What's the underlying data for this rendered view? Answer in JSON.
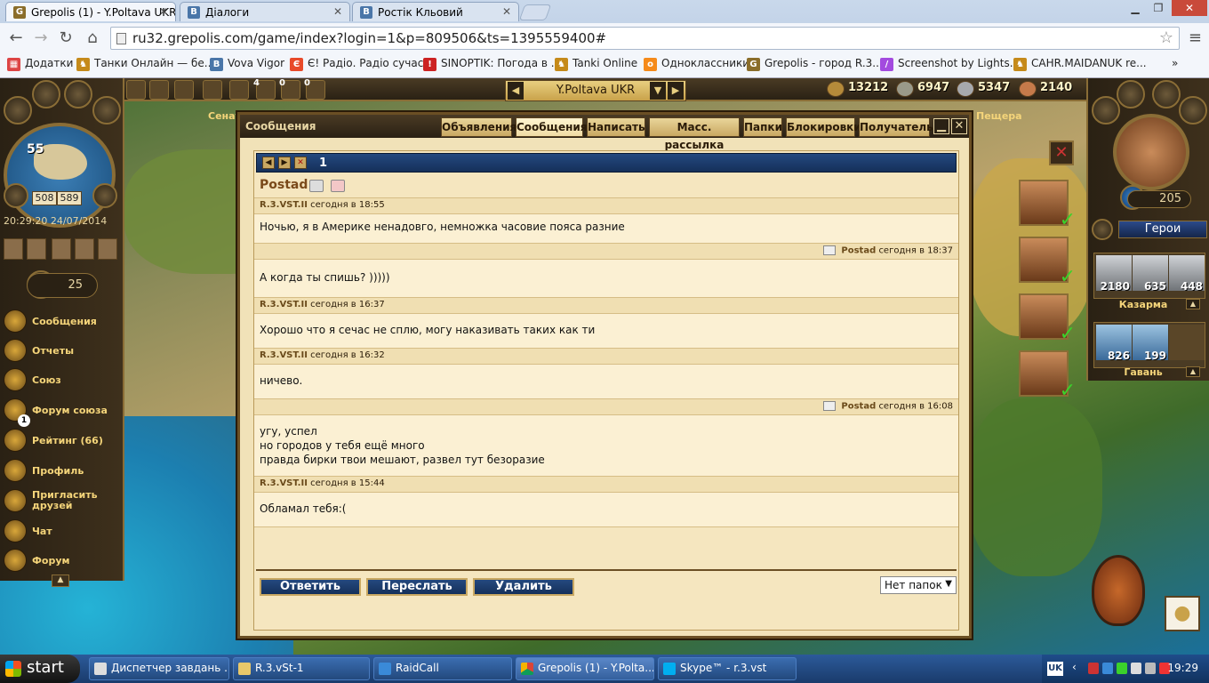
{
  "browser": {
    "tabs": [
      {
        "label": "Grepolis (1) - Y.Poltava UKR",
        "favicon": "G",
        "color": "#8a6d2a"
      },
      {
        "label": "Діалоги",
        "favicon": "В",
        "color": "#4a76a8"
      },
      {
        "label": "Ростік Кльовий",
        "favicon": "В",
        "color": "#4a76a8"
      }
    ],
    "url": "ru32.grepolis.com/game/index?login=1&p=809506&ts=1395559400#",
    "bookmarks": [
      {
        "label": "Додатки",
        "color": "#d44"
      },
      {
        "label": "Танки Онлайн — бе...",
        "color": "#c58a1a"
      },
      {
        "label": "Vova Vigor",
        "color": "#4a76a8"
      },
      {
        "label": "Є! Радіо. Радіо сучас...",
        "color": "#e84a2a"
      },
      {
        "label": "SINOPTIK: Погода в ...",
        "color": "#c22"
      },
      {
        "label": "Tanki Online",
        "color": "#c58a1a"
      },
      {
        "label": "Одноклассники",
        "color": "#f58a1a"
      },
      {
        "label": "Grepolis - город R.3....",
        "color": "#8a6d2a"
      },
      {
        "label": "Screenshot by Lights...",
        "color": "#a34adf"
      },
      {
        "label": "CAHR.MAIDANUK re...",
        "color": "#c58a1a"
      }
    ],
    "more": "»"
  },
  "game": {
    "town_name": "Y.Poltava UKR",
    "resources": {
      "wood": "13212",
      "stone": "6947",
      "silver": "5347",
      "population": "2140"
    },
    "tools": {
      "count_a": "4",
      "count_b": "0",
      "count_c": "0"
    },
    "map_labels": {
      "senate": "Сенат",
      "cave": "Пещера"
    },
    "level": "55",
    "coords": {
      "x": "508",
      "y": "589"
    },
    "clock": "20:29:20 24/07/2014",
    "favor": "25",
    "menu": [
      {
        "label": "Сообщения",
        "name": "menu-messages"
      },
      {
        "label": "Отчеты",
        "name": "menu-reports"
      },
      {
        "label": "Союз",
        "name": "menu-alliance"
      },
      {
        "label": "Форум союза",
        "name": "menu-alliance-forum",
        "badge": "1"
      },
      {
        "label": "Рейтинг (66)",
        "name": "menu-ranking"
      },
      {
        "label": "Профиль",
        "name": "menu-profile"
      },
      {
        "label": "Пригласить друзей",
        "name": "menu-invite"
      },
      {
        "label": "Чат",
        "name": "menu-chat"
      },
      {
        "label": "Форум",
        "name": "menu-forum"
      }
    ],
    "hero_count": "205",
    "heroes_label": "Герои",
    "barracks": {
      "label": "Казарма",
      "units": [
        "2180",
        "635",
        "448"
      ]
    },
    "harbor": {
      "label": "Гавань",
      "units": [
        "826",
        "199"
      ]
    }
  },
  "dialog": {
    "title": "Сообщения",
    "tabs": [
      "Объявления",
      "Сообщения",
      "Написать",
      "Масс. рассылка",
      "Папки",
      "Блокировки",
      "Получатель"
    ],
    "thread_number": "1",
    "sender": "Postad",
    "messages": [
      {
        "author": "R.3.VST.II",
        "time": "сегодня в 18:55",
        "align": "left",
        "lines": [
          "Ночью, я в Америке ненадовго, немножка часовие пояса разние"
        ]
      },
      {
        "author": "Postad",
        "time": "сегодня в 18:37",
        "align": "right",
        "lines": [
          "А когда ты спишь? )))))"
        ]
      },
      {
        "author": "R.3.VST.II",
        "time": "сегодня в 16:37",
        "align": "left",
        "lines": [
          "Хорошо что я сечас не сплю, могу наказивать таких как ти"
        ]
      },
      {
        "author": "R.3.VST.II",
        "time": "сегодня в 16:32",
        "align": "left",
        "lines": [
          "ничево."
        ]
      },
      {
        "author": "Postad",
        "time": "сегодня в 16:08",
        "align": "right",
        "lines": [
          "угу, успел",
          "но городов у тебя ещё много",
          "правда бирки твои мешают, развел тут безоразие"
        ]
      },
      {
        "author": "R.3.VST.II",
        "time": "сегодня в 15:44",
        "align": "left",
        "lines": [
          "Обламал тебя:("
        ]
      }
    ],
    "buttons": {
      "reply": "Ответить",
      "forward": "Переслать",
      "delete": "Удалить"
    },
    "folder": "Нет папок"
  },
  "taskbar": {
    "start": "start",
    "items": [
      "Диспетчер завдань ...",
      "R.3.vSt-1",
      "RaidCall",
      "Grepolis (1) - Y.Polta...",
      "Skype™ - r.3.vst"
    ],
    "lang": "UK",
    "time": "19:29"
  }
}
